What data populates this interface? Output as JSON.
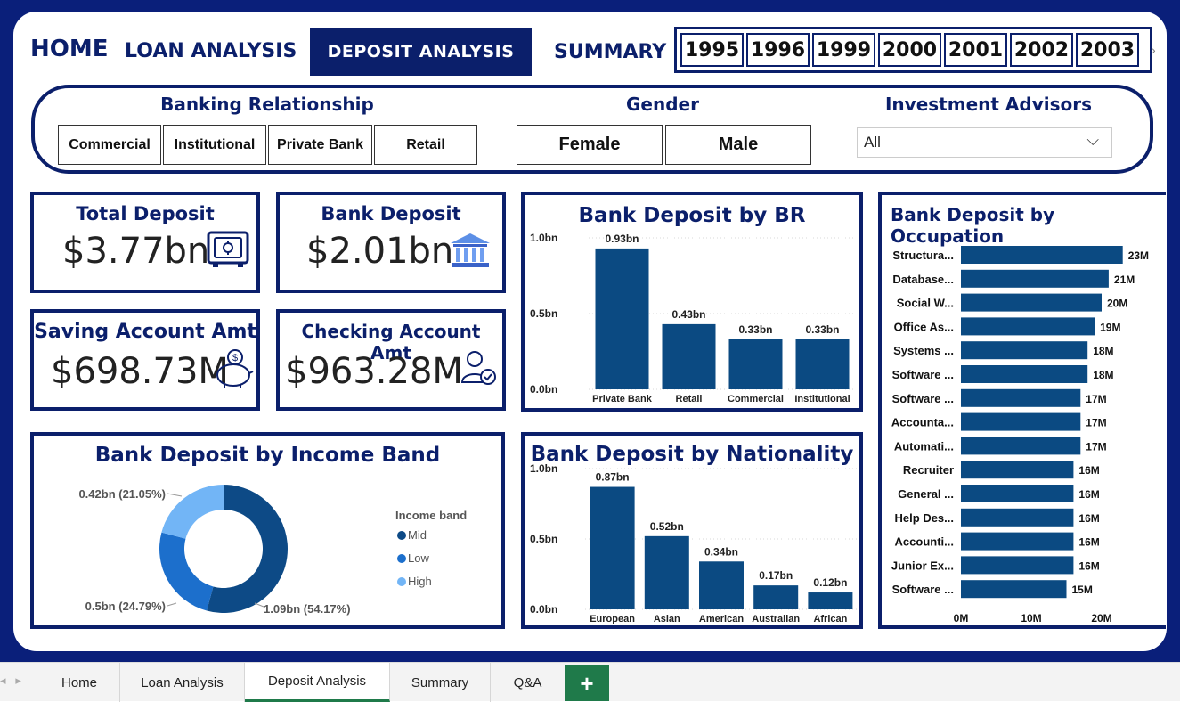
{
  "nav": {
    "home": "HOME",
    "loan": "LOAN ANALYSIS",
    "deposit": "DEPOSIT ANALYSIS",
    "summary": "SUMMARY"
  },
  "years": [
    "1995",
    "1996",
    "1999",
    "2000",
    "2001",
    "2002",
    "2003"
  ],
  "filters": {
    "br_label": "Banking Relationship",
    "br_options": [
      "Commercial",
      "Institutional",
      "Private Bank",
      "Retail"
    ],
    "gender_label": "Gender",
    "gender_options": [
      "Female",
      "Male"
    ],
    "advisor_label": "Investment Advisors",
    "advisor_value": "All"
  },
  "kpis": {
    "total_deposit": {
      "label": "Total Deposit",
      "value": "$3.77bn"
    },
    "bank_deposit": {
      "label": "Bank Deposit",
      "value": "$2.01bn"
    },
    "saving": {
      "label": "Saving Account Amt",
      "value": "$698.73M"
    },
    "checking": {
      "label": "Checking Account Amt",
      "value": "$963.28M"
    }
  },
  "colors": {
    "navy": "#0b1f6b",
    "bar": "#0b4a82",
    "mid": "#0d4a86",
    "low": "#1c6fcc",
    "high": "#72b5f6",
    "tab_green": "#1f7a4a"
  },
  "chart_data": [
    {
      "id": "br",
      "type": "bar",
      "title": "Bank Deposit by BR",
      "categories": [
        "Private Bank",
        "Retail",
        "Commercial",
        "Institutional"
      ],
      "values": [
        0.93,
        0.43,
        0.33,
        0.33
      ],
      "labels": [
        "0.93bn",
        "0.43bn",
        "0.33bn",
        "0.33bn"
      ],
      "yticks": [
        "1.0bn",
        "0.5bn",
        "0.0bn"
      ],
      "ylim": [
        0,
        1.0
      ]
    },
    {
      "id": "nationality",
      "type": "bar",
      "title": "Bank Deposit by Nationality",
      "categories": [
        "European",
        "Asian",
        "American",
        "Australian",
        "African"
      ],
      "values": [
        0.87,
        0.52,
        0.34,
        0.17,
        0.12
      ],
      "labels": [
        "0.87bn",
        "0.52bn",
        "0.34bn",
        "0.17bn",
        "0.12bn"
      ],
      "yticks": [
        "1.0bn",
        "0.5bn",
        "0.0bn"
      ],
      "ylim": [
        0,
        1.0
      ]
    },
    {
      "id": "income",
      "type": "pie",
      "title": "Bank Deposit by Income Band",
      "legend_title": "Income band",
      "categories": [
        "Mid",
        "Low",
        "High"
      ],
      "values": [
        1.09,
        0.5,
        0.42
      ],
      "percents": [
        54.17,
        24.79,
        21.05
      ],
      "labels": [
        "1.09bn (54.17%)",
        "0.5bn (24.79%)",
        "0.42bn (21.05%)"
      ]
    },
    {
      "id": "occupation",
      "type": "bar",
      "orientation": "horizontal",
      "title": "Bank Deposit by Occupation",
      "categories": [
        "Structura...",
        "Database...",
        "Social W...",
        "Office As...",
        "Systems ...",
        "Software ...",
        "Software ...",
        "Accounta...",
        "Automati...",
        "Recruiter",
        "General ...",
        "Help Des...",
        "Accounti...",
        "Junior Ex...",
        "Software ..."
      ],
      "values": [
        23,
        21,
        20,
        19,
        18,
        18,
        17,
        17,
        17,
        16,
        16,
        16,
        16,
        16,
        15
      ],
      "labels": [
        "23M",
        "21M",
        "20M",
        "19M",
        "18M",
        "18M",
        "17M",
        "17M",
        "17M",
        "16M",
        "16M",
        "16M",
        "16M",
        "16M",
        "15M"
      ],
      "xticks": [
        "0M",
        "10M",
        "20M"
      ],
      "xlim": [
        0,
        20
      ]
    }
  ],
  "tabs": [
    "Home",
    "Loan Analysis",
    "Deposit Analysis",
    "Summary",
    "Q&A"
  ],
  "add_tab": "+"
}
